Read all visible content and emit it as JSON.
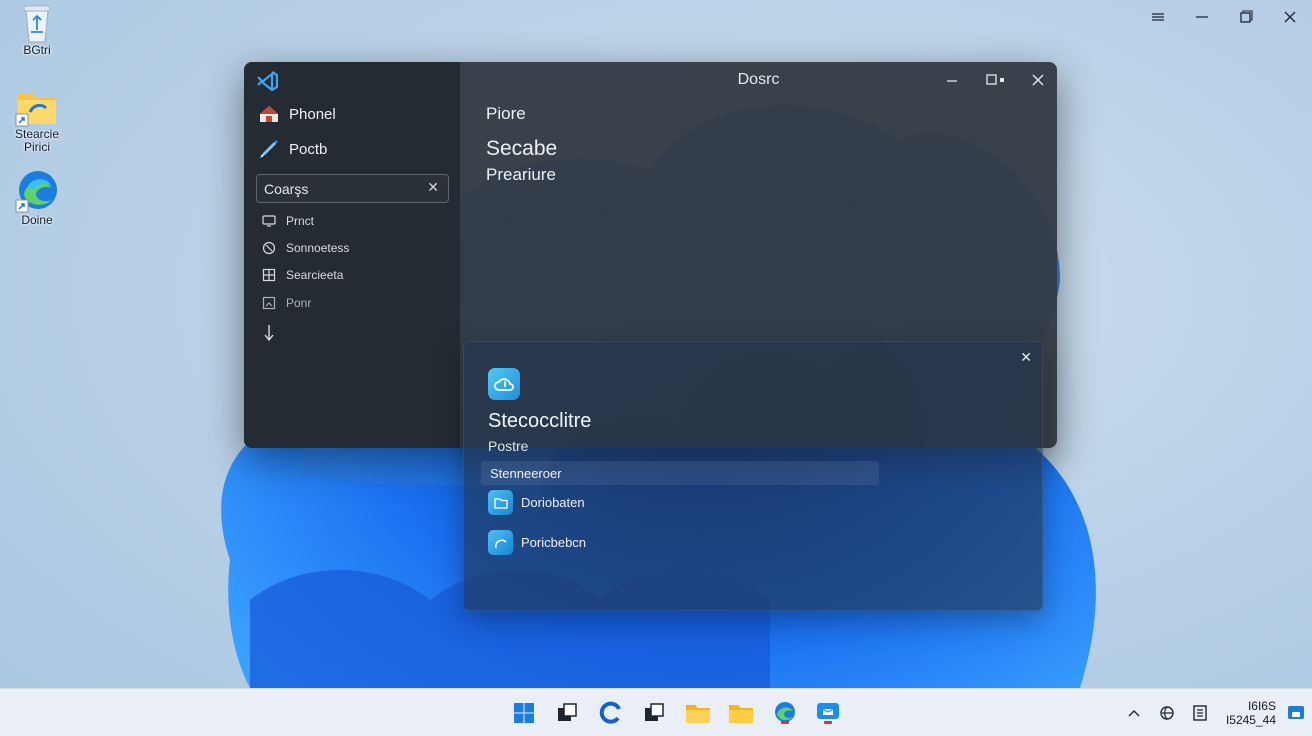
{
  "desktop": {
    "icons": [
      {
        "label": "BGtri",
        "icon": "recycle-bin-icon"
      },
      {
        "label": "Stearcie Pirici",
        "icon": "folder-shortcut-icon"
      },
      {
        "label": "Doine",
        "icon": "edge-shortcut-icon"
      }
    ],
    "top_controls": [
      "menu-icon",
      "minimize-icon",
      "restore-icon",
      "close-icon"
    ]
  },
  "main_window": {
    "title": "Dosrc",
    "sidebar": {
      "primary_items": [
        {
          "label": "Phonel",
          "icon": "home-icon"
        },
        {
          "label": "Poctb",
          "icon": "pen-icon"
        }
      ],
      "search": {
        "value": "Coarşs",
        "placeholder": ""
      },
      "secondary_items": [
        {
          "label": "Prnct",
          "icon": "monitor-icon"
        },
        {
          "label": "Sonnoetess",
          "icon": "accessibility-icon"
        },
        {
          "label": "Searcieeta",
          "icon": "grid-icon"
        },
        {
          "label": "Ponr",
          "icon": "image-icon"
        }
      ],
      "footer_icon": "arrow-down-icon"
    },
    "content": {
      "heading": "Piore",
      "title": "Secabe",
      "subtitle": "Preariure"
    }
  },
  "flyout": {
    "app_icon": "cloud-app-icon",
    "title": "Stecocclitre",
    "subtitle": "Postre",
    "selected_row": "Stenneeroer",
    "items": [
      {
        "label": "Doriobaten",
        "icon": "folder-icon"
      },
      {
        "label": "Poricbebcn",
        "icon": "speed-icon"
      }
    ]
  },
  "taskbar": {
    "apps": [
      "start-icon",
      "task-view-icon",
      "edge-icon",
      "widgets-icon",
      "file-explorer-icon",
      "folder-icon",
      "edge-dev-icon",
      "store-icon"
    ],
    "tray_icons": [
      "chevron-up-icon",
      "network-icon",
      "notes-icon"
    ],
    "clock": {
      "time": "I6I6S",
      "date": "I5245_44"
    }
  }
}
